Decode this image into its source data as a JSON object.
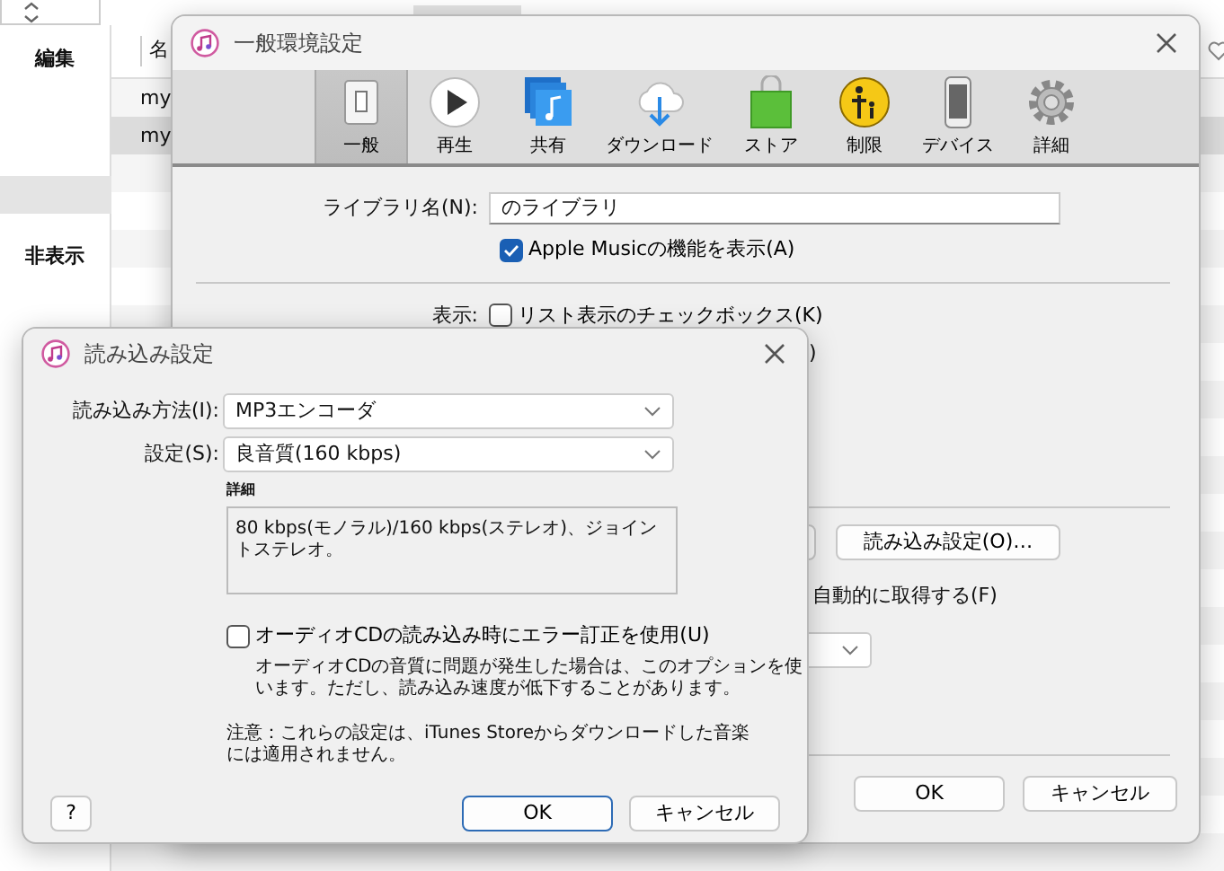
{
  "app": {
    "sidebar": [
      {
        "label": "編集"
      },
      {
        "label": "非表示"
      }
    ],
    "column_1": "名",
    "rows": [
      {
        "cell": "my",
        "selected": false
      },
      {
        "cell": "my",
        "selected": true
      }
    ]
  },
  "preferences": {
    "title": "一般環境設定",
    "toolbar": [
      {
        "label": "一般",
        "selected": true
      },
      {
        "label": "再生",
        "selected": false
      },
      {
        "label": "共有",
        "selected": false
      },
      {
        "label": "ダウンロード",
        "selected": false
      },
      {
        "label": "ストア",
        "selected": false
      },
      {
        "label": "制限",
        "selected": false
      },
      {
        "label": "デバイス",
        "selected": false
      },
      {
        "label": "詳細",
        "selected": false
      }
    ],
    "library_label": "ライブラリ名(N):",
    "library_value": "のライブラリ",
    "apple_music": {
      "label": "Apple Musicの機能を表示(A)",
      "checked": true
    },
    "display_label": "表示:",
    "list_checkbox": {
      "label": "リスト表示のチェックボックス(K)",
      "checked": false
    },
    "cut_text": ")",
    "import_button": "読み込み設定(O)…",
    "auto_text": "自動的に取得する(F)",
    "buttons": [
      "OK",
      "キャンセル"
    ]
  },
  "import_dialog": {
    "title": "読み込み設定",
    "method_label": "読み込み方法(I):",
    "method_value": "MP3エンコーダ",
    "setting_label": "設定(S):",
    "setting_value": "良音質(160 kbps)",
    "detail_label": "詳細",
    "detail_text": "80 kbps(モノラル)/160 kbps(ステレオ)、ジョイントステレオ。",
    "error_correction": {
      "label": "オーディオCDの読み込み時にエラー訂正を使用(U)",
      "checked": false
    },
    "error_hint": "オーディオCDの音質に問題が発生した場合は、このオプションを使います。ただし、読み込み速度が低下することがあります。",
    "note": "注意：これらの設定は、iTunes Storeからダウンロードした音楽には適用されません。",
    "help": "?",
    "buttons": [
      "OK",
      "キャンセル"
    ]
  }
}
